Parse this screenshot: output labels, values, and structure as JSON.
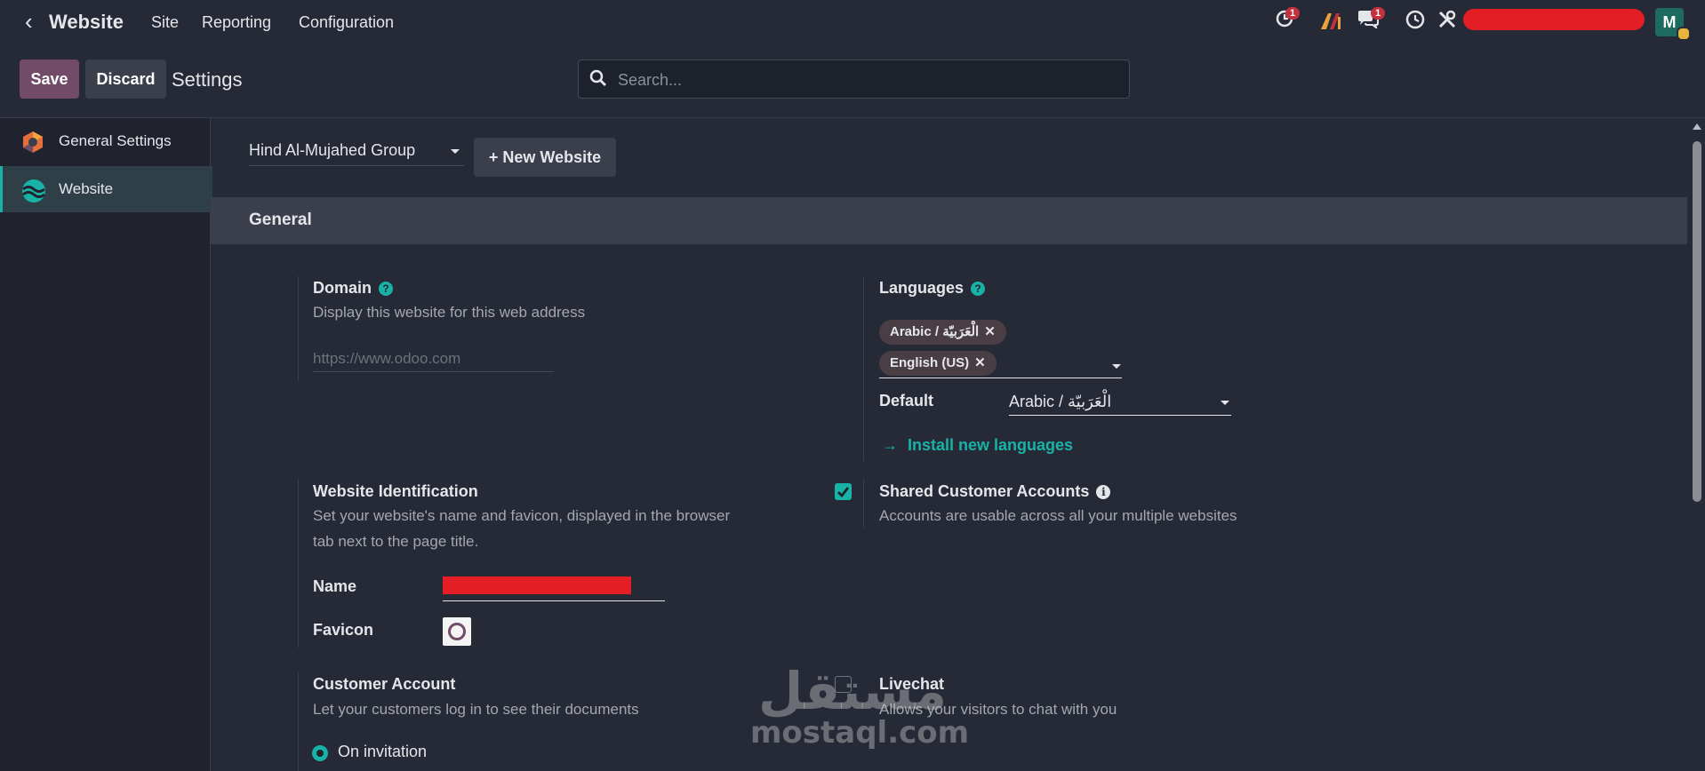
{
  "topbar": {
    "app_name": "Website",
    "menu": [
      "Site",
      "Reporting",
      "Configuration"
    ],
    "activity_badge": "1",
    "messages_badge": "1",
    "user_initial": "M"
  },
  "controlbar": {
    "save_label": "Save",
    "discard_label": "Discard",
    "breadcrumb": "Settings",
    "search_placeholder": "Search..."
  },
  "sidebar": {
    "items": [
      {
        "label": "General Settings"
      },
      {
        "label": "Website"
      }
    ]
  },
  "settings": {
    "website_select": "Hind Al-Mujahed Group",
    "new_website_label": "+ New Website",
    "section_title": "General",
    "domain": {
      "title": "Domain",
      "help": "?",
      "description": "Display this website for this web address",
      "placeholder": "https://www.odoo.com"
    },
    "languages": {
      "title": "Languages",
      "help": "?",
      "tags": [
        "Arabic / الْعَرَبيّة",
        "English (US)"
      ],
      "default_label": "Default",
      "default_value": "Arabic / الْعَرَبيّة",
      "install_link": "Install new languages",
      "install_arrow": "→"
    },
    "identification": {
      "title": "Website Identification",
      "description_line1": "Set your website's name and favicon, displayed in the browser",
      "description_line2": "tab next to the page title.",
      "name_label": "Name",
      "favicon_label": "Favicon"
    },
    "shared_accounts": {
      "title": "Shared Customer Accounts",
      "info": "i",
      "checked": true,
      "description": "Accounts are usable across all your multiple websites"
    },
    "customer_account": {
      "title": "Customer Account",
      "description": "Let your customers log in to see their documents",
      "option": "On invitation"
    },
    "livechat": {
      "title": "Livechat",
      "description": "Allows your visitors to chat with you"
    }
  },
  "watermark": {
    "arabic": "مستقل",
    "latin": "mostaql.com"
  },
  "colors": {
    "brand": "#714b67",
    "accent": "#19b2a7",
    "background": "#262a36",
    "badge": "#c5303e"
  }
}
